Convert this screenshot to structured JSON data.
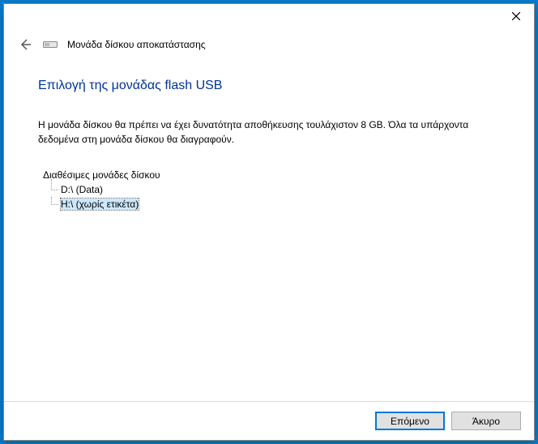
{
  "header": {
    "wizard_title": "Μονάδα δίσκου αποκατάστασης"
  },
  "main": {
    "heading": "Επιλογή της μονάδας flash USB",
    "warning": "Η μονάδα δίσκου θα πρέπει να έχει δυνατότητα αποθήκευσης τουλάχιστον 8 GB. Όλα τα υπάρχοντα δεδομένα στη μονάδα δίσκου θα διαγραφούν.",
    "drives_label": "Διαθέσιμες μονάδες δίσκου",
    "drives": [
      {
        "label": "D:\\ (Data)"
      },
      {
        "label": "H:\\ (χωρίς ετικέτα)"
      }
    ]
  },
  "footer": {
    "next": "Επόμενο",
    "cancel": "Άκυρο"
  }
}
